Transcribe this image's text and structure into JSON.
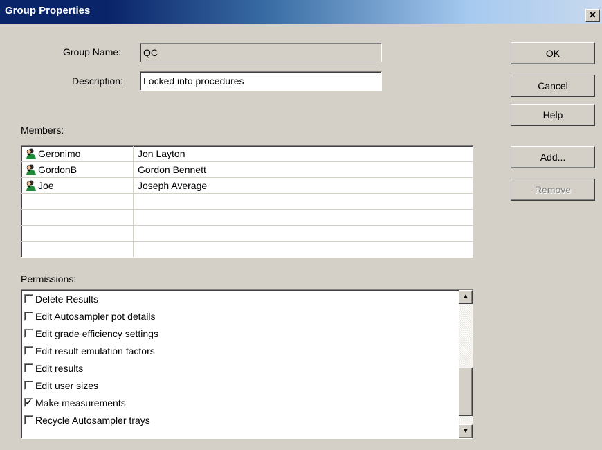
{
  "window": {
    "title": "Group Properties",
    "close_glyph": "✕"
  },
  "form": {
    "group_name_label": "Group Name:",
    "group_name_value": "QC",
    "description_label": "Description:",
    "description_value": "Locked into procedures",
    "members_label": "Members:",
    "permissions_label": "Permissions:"
  },
  "buttons": {
    "ok": "OK",
    "cancel": "Cancel",
    "help": "Help",
    "add": "Add...",
    "remove": "Remove"
  },
  "members": [
    {
      "username": "Geronimo",
      "fullname": "Jon Layton",
      "icon": "user-icon"
    },
    {
      "username": "GordonB",
      "fullname": "Gordon Bennett",
      "icon": "user-icon"
    },
    {
      "username": "Joe",
      "fullname": "Joseph Average",
      "icon": "user-icon"
    }
  ],
  "permissions": [
    {
      "label": "Delete Results",
      "checked": false
    },
    {
      "label": "Edit Autosampler pot details",
      "checked": false
    },
    {
      "label": "Edit grade efficiency settings",
      "checked": false
    },
    {
      "label": "Edit result emulation factors",
      "checked": false
    },
    {
      "label": "Edit results",
      "checked": false
    },
    {
      "label": "Edit user sizes",
      "checked": false
    },
    {
      "label": "Make measurements",
      "checked": true
    },
    {
      "label": "Recycle Autosampler trays",
      "checked": false
    }
  ],
  "colors": {
    "titlebar_start": "#0a246a",
    "titlebar_end": "#c8d8ee",
    "dialog_bg": "#d4d0c8",
    "disabled_text": "#808080"
  }
}
